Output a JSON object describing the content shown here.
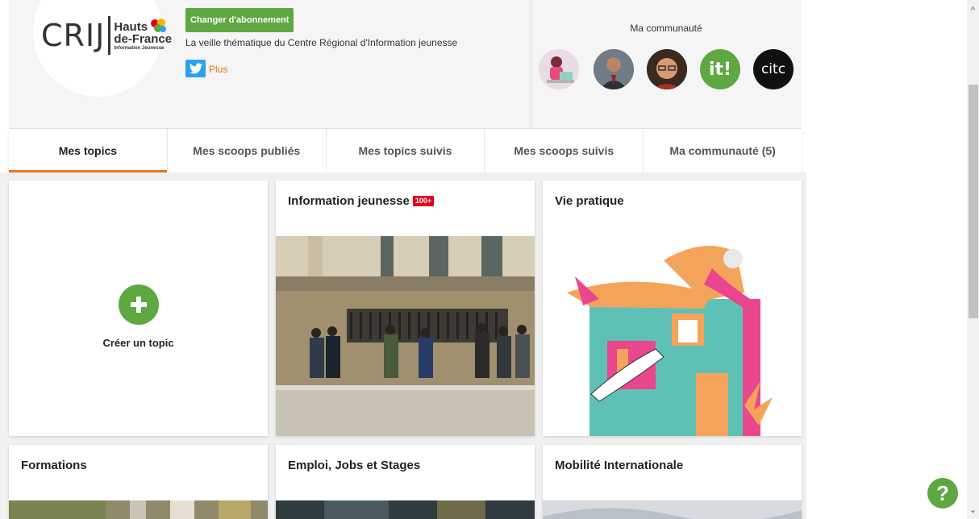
{
  "header": {
    "logo_crij": "CRIJ",
    "logo_line1": "Hauts",
    "logo_line2": "de-France",
    "logo_line3": "Information Jeunesse",
    "subscription_button": "Changer d'abonnement",
    "tagline": "La veille thématique du Centre Régional d'Information jeunesse",
    "more_link": "Plus",
    "community_title": "Ma communauté"
  },
  "tabs": [
    {
      "label": "Mes topics",
      "active": true
    },
    {
      "label": "Mes scoops publiés",
      "active": false
    },
    {
      "label": "Mes topics suivis",
      "active": false
    },
    {
      "label": "Mes scoops suivis",
      "active": false
    },
    {
      "label": "Ma communauté (5)",
      "active": false
    }
  ],
  "create_topic": {
    "label": "Créer un topic"
  },
  "topics": [
    {
      "title": "Information jeunesse",
      "badge": "100+"
    },
    {
      "title": "Vie pratique"
    },
    {
      "title": "Formations"
    },
    {
      "title": "Emploi, Jobs et Stages"
    },
    {
      "title": "Mobilité Internationale"
    }
  ],
  "avatars": [
    "avatar-illustration",
    "avatar-man-suit",
    "avatar-man-glasses",
    "avatar-it-logo",
    "avatar-citc-logo"
  ],
  "avatar_citc_text": "citc",
  "avatar_it_text": "it!",
  "help": "?",
  "colors": {
    "accent": "#e77817",
    "green": "#5fa741",
    "badge": "#e3001b",
    "twitter": "#2aa3ef"
  }
}
